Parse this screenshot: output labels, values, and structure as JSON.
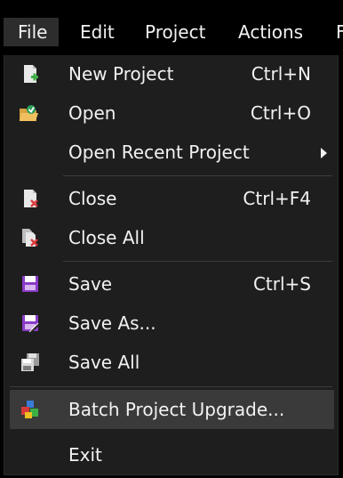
{
  "menubar": {
    "items": [
      {
        "label": "File",
        "active": true
      },
      {
        "label": "Edit"
      },
      {
        "label": "Project"
      },
      {
        "label": "Actions"
      },
      {
        "label": "F"
      }
    ]
  },
  "file_menu": {
    "items": [
      {
        "label": "New Project",
        "shortcut": "Ctrl+N",
        "icon": "new-project-icon"
      },
      {
        "label": "Open",
        "shortcut": "Ctrl+O",
        "icon": "open-folder-icon"
      },
      {
        "label": "Open Recent Project",
        "shortcut": "",
        "icon": "",
        "submenu": true
      },
      {
        "label": "Close",
        "shortcut": "Ctrl+F4",
        "icon": "close-document-icon"
      },
      {
        "label": "Close All",
        "shortcut": "",
        "icon": "close-all-documents-icon"
      },
      {
        "label": "Save",
        "shortcut": "Ctrl+S",
        "icon": "save-icon"
      },
      {
        "label": "Save As...",
        "shortcut": "",
        "icon": "save-as-icon"
      },
      {
        "label": "Save All",
        "shortcut": "",
        "icon": "save-all-icon"
      },
      {
        "label": "Batch Project Upgrade...",
        "shortcut": "",
        "icon": "batch-upgrade-icon",
        "highlighted": true
      },
      {
        "label": "Exit",
        "shortcut": "",
        "icon": ""
      }
    ]
  },
  "colors": {
    "menu_background": "#1e1e1e",
    "highlight": "#3a3a3a",
    "text": "#f2f2f2",
    "save_purple": "#8a3cc8",
    "close_red": "#d83a3a",
    "new_green": "#3cb043"
  }
}
